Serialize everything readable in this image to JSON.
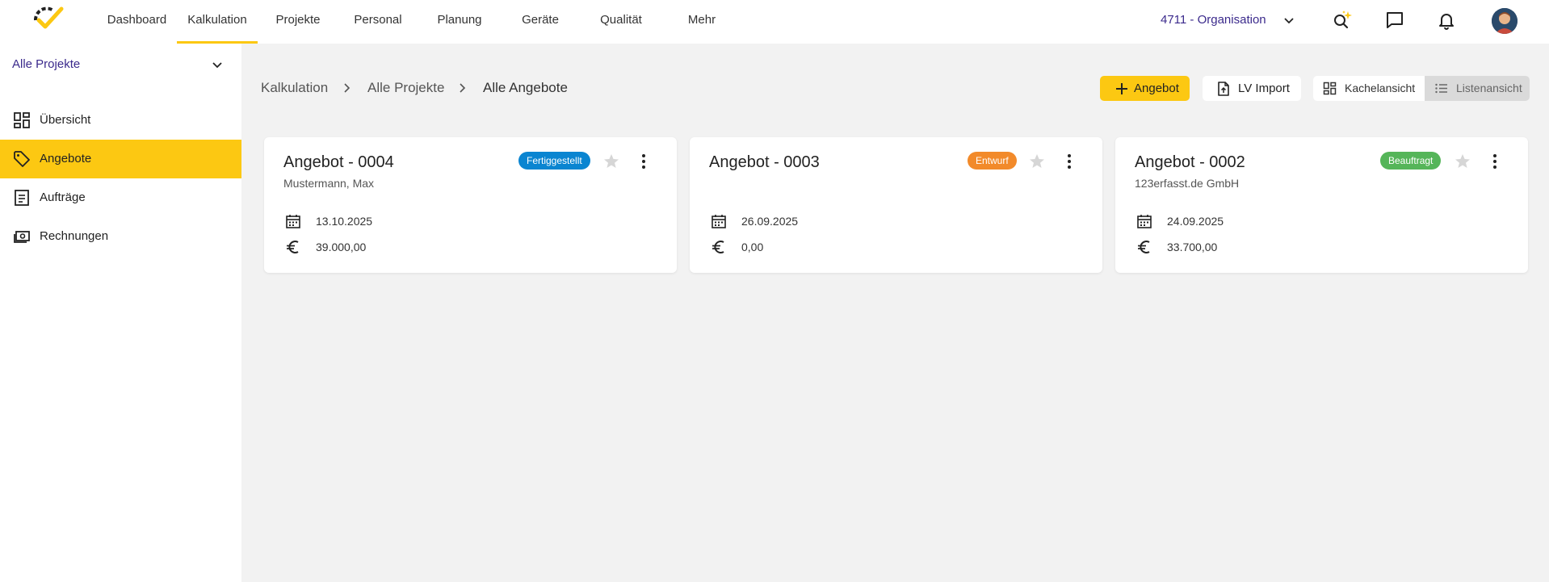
{
  "nav": {
    "items": [
      {
        "label": "Dashboard",
        "active": false
      },
      {
        "label": "Kalkulation",
        "active": true
      },
      {
        "label": "Projekte",
        "active": false
      },
      {
        "label": "Personal",
        "active": false
      },
      {
        "label": "Planung",
        "active": false
      },
      {
        "label": "Geräte",
        "active": false
      },
      {
        "label": "Qualität",
        "active": false
      },
      {
        "label": "Mehr",
        "active": false
      }
    ],
    "organisation": "4711 - Organisation",
    "icons": [
      "search-sparkle-icon",
      "chat-icon",
      "bell-icon",
      "user-avatar"
    ]
  },
  "sidebar": {
    "project_select": "Alle Projekte",
    "items": [
      {
        "label": "Übersicht",
        "icon": "dashboard-icon",
        "active": false
      },
      {
        "label": "Angebote",
        "icon": "tag-icon",
        "active": true
      },
      {
        "label": "Aufträge",
        "icon": "document-icon",
        "active": false
      },
      {
        "label": "Rechnungen",
        "icon": "money-icon",
        "active": false
      }
    ]
  },
  "breadcrumb": [
    "Kalkulation",
    "Alle Projekte",
    "Alle Angebote"
  ],
  "actions": {
    "add_offer": "Angebot",
    "lv_import": "LV Import",
    "tile_view": "Kachelansicht",
    "list_view": "Listenansicht"
  },
  "colors": {
    "accent": "#fcc812",
    "org_text": "#3b2a8c",
    "status_completed": "#0a85d1",
    "status_draft": "#f28a2a",
    "status_ordered": "#55b559"
  },
  "offers": [
    {
      "title": "Angebot - 0004",
      "customer": "Mustermann, Max",
      "status": "Fertiggestellt",
      "status_color": "#0a85d1",
      "date": "13.10.2025",
      "amount": "39.000,00"
    },
    {
      "title": "Angebot - 0003",
      "customer": "",
      "status": "Entwurf",
      "status_color": "#f28a2a",
      "date": "26.09.2025",
      "amount": "0,00"
    },
    {
      "title": "Angebot - 0002",
      "customer": "123erfasst.de GmbH",
      "status": "Beauftragt",
      "status_color": "#55b559",
      "date": "24.09.2025",
      "amount": "33.700,00"
    }
  ]
}
